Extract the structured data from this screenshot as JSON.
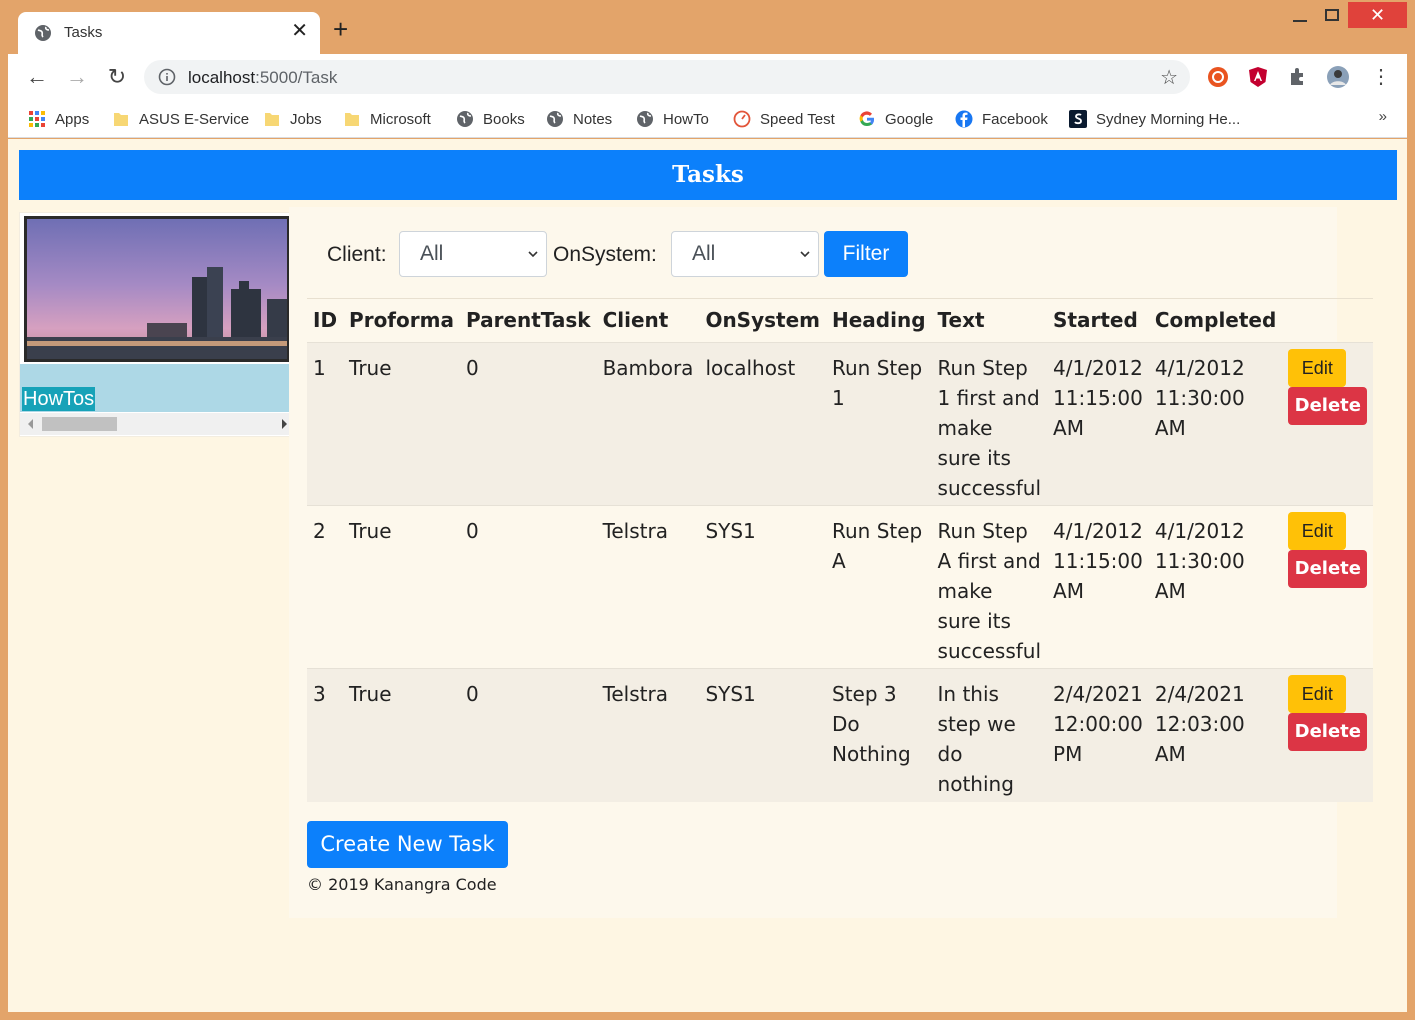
{
  "browser": {
    "tab_title": "Tasks",
    "url_host": "localhost",
    "url_path": ":5000/Task",
    "bookmarks": [
      {
        "label": "Apps",
        "icon": "apps-grid-icon"
      },
      {
        "label": "ASUS E-Service",
        "icon": "folder-icon"
      },
      {
        "label": "Jobs",
        "icon": "folder-icon"
      },
      {
        "label": "Microsoft",
        "icon": "folder-icon"
      },
      {
        "label": "Books",
        "icon": "globe-icon"
      },
      {
        "label": "Notes",
        "icon": "globe-icon"
      },
      {
        "label": "HowTo",
        "icon": "globe-icon"
      },
      {
        "label": "Speed Test",
        "icon": "speedometer-icon"
      },
      {
        "label": "Google",
        "icon": "google-icon"
      },
      {
        "label": "Facebook",
        "icon": "facebook-icon"
      },
      {
        "label": "Sydney Morning He...",
        "icon": "smh-icon"
      }
    ],
    "more_bookmarks": "»"
  },
  "page": {
    "header_title": "Tasks",
    "sidebar_link": "HowTos",
    "filters": {
      "client_label": "Client:",
      "client_value": "All",
      "onsystem_label": "OnSystem:",
      "onsystem_value": "All",
      "filter_button": "Filter"
    },
    "table": {
      "headers": [
        "ID",
        "Proforma",
        "ParentTask",
        "Client",
        "OnSystem",
        "Heading",
        "Text",
        "Started",
        "Completed"
      ],
      "rows": [
        {
          "id": "1",
          "proforma": "True",
          "parent": "0",
          "client": "Bambora",
          "onsystem": "localhost",
          "heading": "Run Step 1",
          "text": "Run Step 1 first and make sure its successful",
          "started": "4/1/2012 11:15:00 AM",
          "completed": "4/1/2012 11:30:00 AM"
        },
        {
          "id": "2",
          "proforma": "True",
          "parent": "0",
          "client": "Telstra",
          "onsystem": "SYS1",
          "heading": "Run Step A",
          "text": "Run Step A first and make sure its successful",
          "started": "4/1/2012 11:15:00 AM",
          "completed": "4/1/2012 11:30:00 AM"
        },
        {
          "id": "3",
          "proforma": "True",
          "parent": "0",
          "client": "Telstra",
          "onsystem": "SYS1",
          "heading": "Step 3 Do Nothing",
          "text": "In this step we do nothing",
          "started": "2/4/2021 12:00:00 PM",
          "completed": "2/4/2021 12:03:00 AM"
        }
      ],
      "edit_label": "Edit",
      "delete_label": "Delete"
    },
    "create_button": "Create New Task",
    "footer": "© 2019 Kanangra Code"
  }
}
